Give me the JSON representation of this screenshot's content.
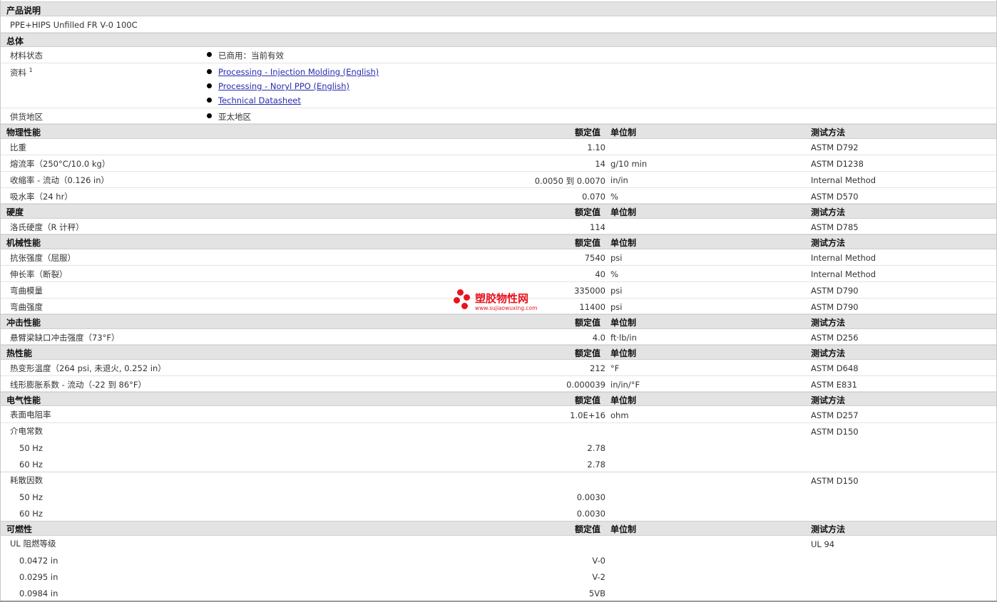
{
  "colhdr": {
    "rated": "额定值",
    "unit": "单位制",
    "method": "测试方法"
  },
  "product": {
    "title": "产品说明",
    "desc": "PPE+HIPS Unfilled FR V-0 100C"
  },
  "general": {
    "title": "总体",
    "status_label": "材料状态",
    "status_value": "已商用：当前有效",
    "docs_label": "资料",
    "docs_sup": "1",
    "docs": [
      "Processing - Injection Molding (English)",
      "Processing - Noryl PPO (English)",
      "Technical Datasheet"
    ],
    "region_label": "供货地区",
    "region_value": "亚太地区"
  },
  "physical": {
    "title": "物理性能",
    "rows": [
      {
        "name": "比重",
        "value": "1.10",
        "unit": "",
        "method": "ASTM D792"
      },
      {
        "name": "熔流率（250°C/10.0 kg）",
        "value": "14",
        "unit": "g/10 min",
        "method": "ASTM D1238"
      },
      {
        "name": "收缩率 - 流动（0.126 in）",
        "value": "0.0050 到 0.0070",
        "unit": "in/in",
        "method": "Internal Method"
      },
      {
        "name": "吸水率（24 hr）",
        "value": "0.070",
        "unit": "%",
        "method": "ASTM D570"
      }
    ]
  },
  "hardness": {
    "title": "硬度",
    "rows": [
      {
        "name": "洛氏硬度（R 计秤）",
        "value": "114",
        "unit": "",
        "method": "ASTM D785"
      }
    ]
  },
  "mechanical": {
    "title": "机械性能",
    "rows": [
      {
        "name": "抗张强度（屈服）",
        "value": "7540",
        "unit": "psi",
        "method": "Internal Method"
      },
      {
        "name": "伸长率（断裂）",
        "value": "40",
        "unit": "%",
        "method": "Internal Method"
      },
      {
        "name": "弯曲模量",
        "value": "335000",
        "unit": "psi",
        "method": "ASTM D790"
      },
      {
        "name": "弯曲强度",
        "value": "11400",
        "unit": "psi",
        "method": "ASTM D790"
      }
    ]
  },
  "impact": {
    "title": "冲击性能",
    "rows": [
      {
        "name": "悬臂梁缺口冲击强度（73°F）",
        "value": "4.0",
        "unit": "ft·lb/in",
        "method": "ASTM D256"
      }
    ]
  },
  "thermal": {
    "title": "热性能",
    "rows": [
      {
        "name": "热变形温度（264 psi, 未退火, 0.252 in）",
        "value": "212",
        "unit": "°F",
        "method": "ASTM D648"
      },
      {
        "name": "线形膨胀系数 - 流动（-22 到 86°F）",
        "value": "0.000039",
        "unit": "in/in/°F",
        "method": "ASTM E831"
      }
    ]
  },
  "electrical": {
    "title": "电气性能",
    "surface": {
      "name": "表面电阻率",
      "value": "1.0E+16",
      "unit": "ohm",
      "method": "ASTM D257"
    },
    "dielectric": {
      "name": "介电常数",
      "method": "ASTM D150",
      "sub": [
        {
          "name": "50 Hz",
          "value": "2.78"
        },
        {
          "name": "60 Hz",
          "value": "2.78"
        }
      ]
    },
    "dissipation": {
      "name": "耗散因数",
      "method": "ASTM D150",
      "sub": [
        {
          "name": "50 Hz",
          "value": "0.0030"
        },
        {
          "name": "60 Hz",
          "value": "0.0030"
        }
      ]
    }
  },
  "flammability": {
    "title": "可燃性",
    "ul": {
      "name": "UL 阻燃等级",
      "method": "UL 94",
      "sub": [
        {
          "name": "0.0472 in",
          "value": "V-0"
        },
        {
          "name": "0.0295 in",
          "value": "V-2"
        },
        {
          "name": "0.0984 in",
          "value": "5VB"
        }
      ]
    }
  },
  "watermark": {
    "text": "塑胶物性网",
    "url": "www.sujiaowuxing.com"
  },
  "colors": {
    "header_bg": "#e3e3e3",
    "link": "#2a2ab0",
    "watermark": "#e8141e"
  }
}
